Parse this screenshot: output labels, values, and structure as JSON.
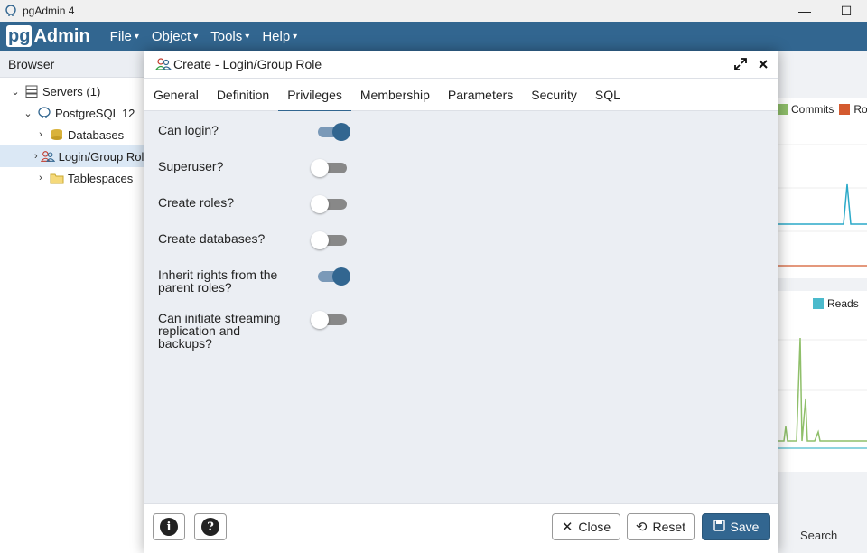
{
  "window": {
    "title": "pgAdmin 4",
    "min_glyph": "—",
    "max_glyph": "☐"
  },
  "nav": {
    "logo_pg": "pg",
    "logo_admin": "Admin",
    "menus": [
      "File",
      "Object",
      "Tools",
      "Help"
    ]
  },
  "browser": {
    "title": "Browser",
    "tree": [
      {
        "label": "Servers (1)",
        "chev": "⌄"
      },
      {
        "label": "PostgreSQL 12",
        "chev": "⌄"
      },
      {
        "label": "Databases",
        "chev": "›"
      },
      {
        "label": "Login/Group Roles",
        "chev": "›"
      },
      {
        "label": "Tablespaces",
        "chev": "›"
      }
    ]
  },
  "dashboard": {
    "legend1": [
      "Commits",
      "Ro"
    ],
    "legend2": [
      "Reads"
    ],
    "search_label": "Search",
    "colors": {
      "commits": "#8fbf6a",
      "rollbacks": "#d45a2f",
      "reads": "#4bbacc",
      "line_teal": "#2aa9c8",
      "line_green": "#8fbf6a"
    }
  },
  "modal": {
    "title": "Create - Login/Group Role",
    "tabs": [
      "General",
      "Definition",
      "Privileges",
      "Membership",
      "Parameters",
      "Security",
      "SQL"
    ],
    "active_tab": "Privileges",
    "privileges": [
      {
        "label": "Can login?",
        "on": true
      },
      {
        "label": "Superuser?",
        "on": false
      },
      {
        "label": "Create roles?",
        "on": false
      },
      {
        "label": "Create databases?",
        "on": false
      },
      {
        "label": "Inherit rights from the parent roles?",
        "on": true
      },
      {
        "label": "Can initiate streaming replication and backups?",
        "on": false
      }
    ],
    "footer": {
      "info_glyph": "i",
      "help_glyph": "?",
      "close_label": "Close",
      "reset_label": "Reset",
      "save_label": "Save"
    }
  },
  "colors": {
    "brand": "#326690",
    "toggle_on_track": "#7a99b8",
    "toggle_off_track": "#888888"
  }
}
